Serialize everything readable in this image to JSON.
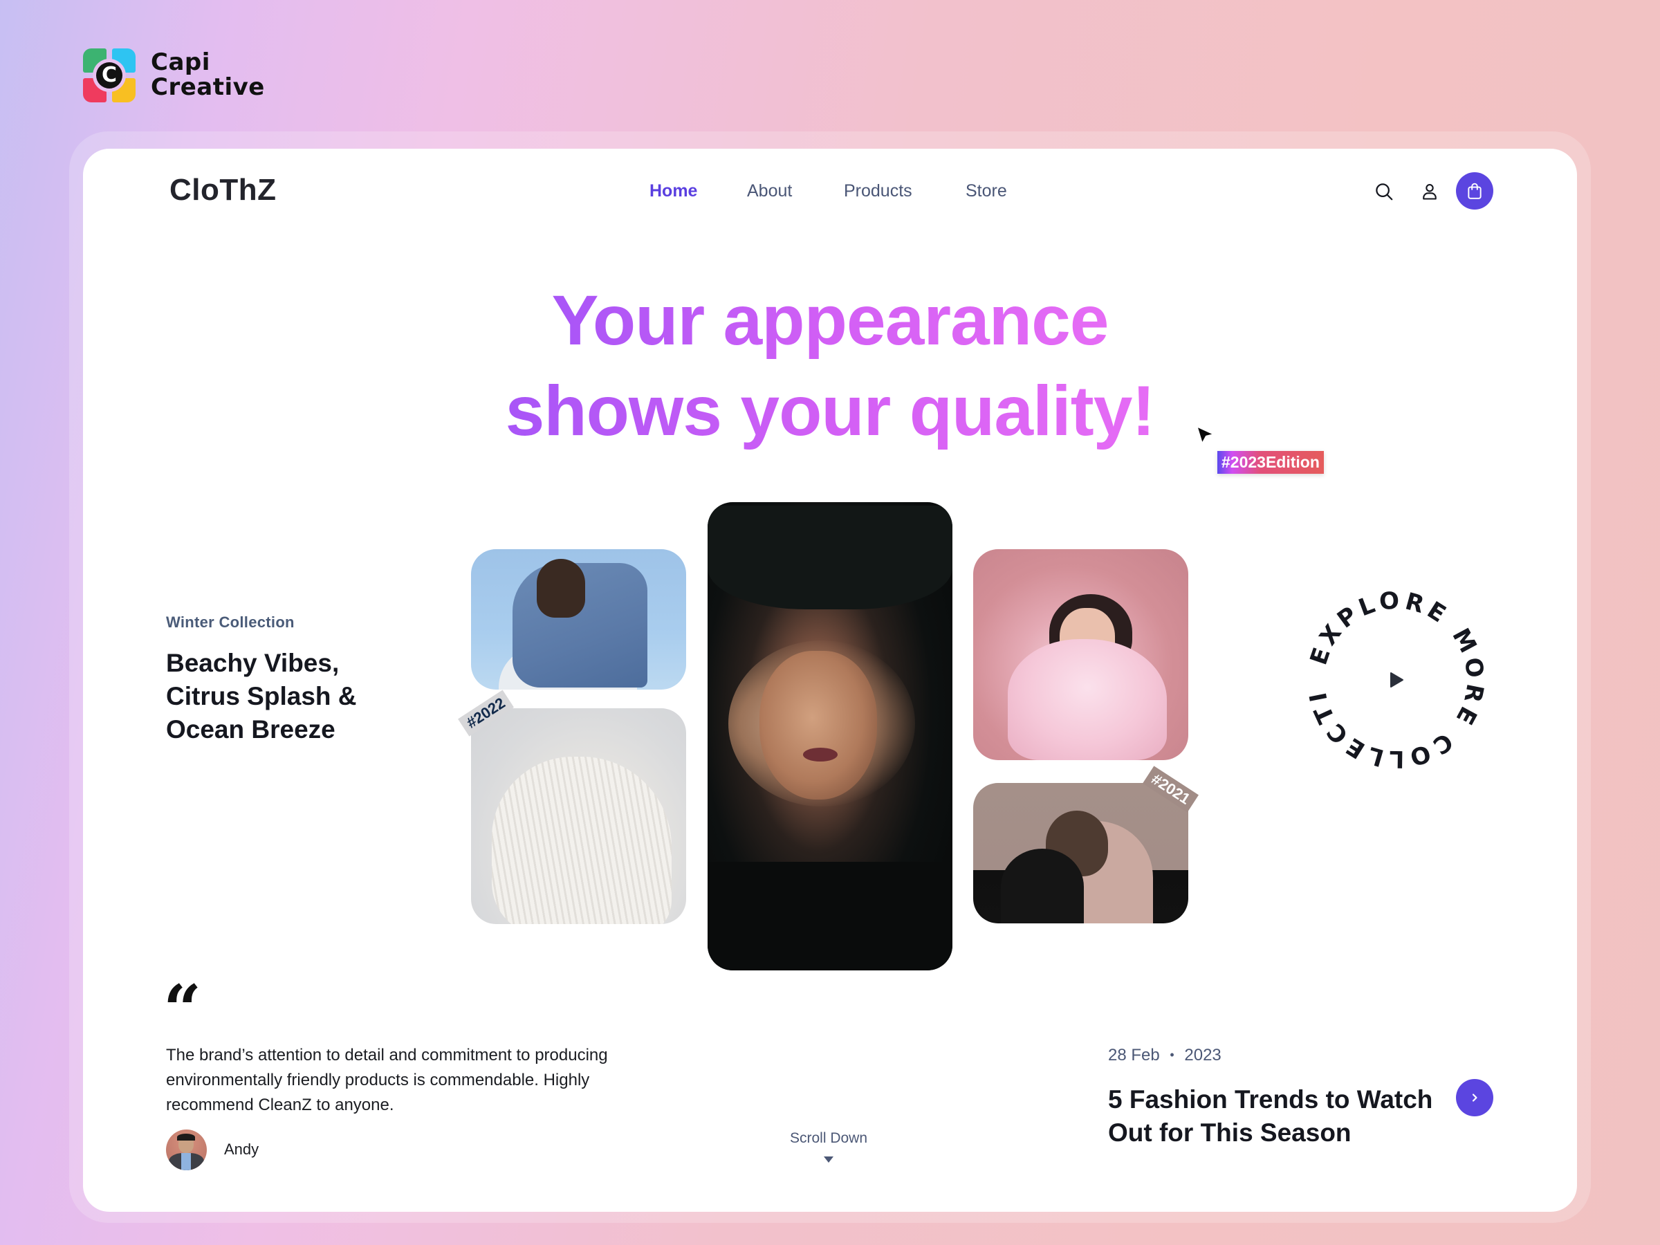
{
  "branding": {
    "studio_name_line1": "Capi",
    "studio_name_line2": "Creative",
    "studio_logo_letter": "C",
    "site_brand": "CloThZ"
  },
  "nav": {
    "items": [
      {
        "label": "Home",
        "active": true
      },
      {
        "label": "About",
        "active": false
      },
      {
        "label": "Products",
        "active": false
      },
      {
        "label": "Store",
        "active": false
      }
    ],
    "icons": [
      "search-icon",
      "user-icon",
      "shopping-bag-icon"
    ]
  },
  "hero": {
    "headline_line1": "Your appearance",
    "headline_line2": "shows your quality!",
    "edition_tag": "#2023Edition"
  },
  "collection": {
    "label": "Winter Collection",
    "title": "Beachy Vibes, Citrus Splash & Ocean Breeze"
  },
  "gallery": {
    "tags": {
      "left": "#2022",
      "right": "#2021"
    }
  },
  "circle_cta": {
    "text": "EXPLORE MORE COLLECTION ",
    "icon": "play-icon"
  },
  "testimonial": {
    "quote_mark": "“",
    "text": "The brand’s attention to detail and commitment to producing environmentally friendly products is commendable. Highly recommend CleanZ to anyone.",
    "author": "Andy"
  },
  "scroll": {
    "label": "Scroll Down"
  },
  "post": {
    "day_month": "28 Feb",
    "separator": "•",
    "year": "2023",
    "title": "5 Fashion Trends to Watch Out for This Season"
  },
  "colors": {
    "accent": "#5b45e0",
    "headline_gradient_start": "#a855f7",
    "headline_gradient_end": "#e66cf5",
    "nav_text": "#4a5676",
    "dark_text": "#15171f"
  }
}
